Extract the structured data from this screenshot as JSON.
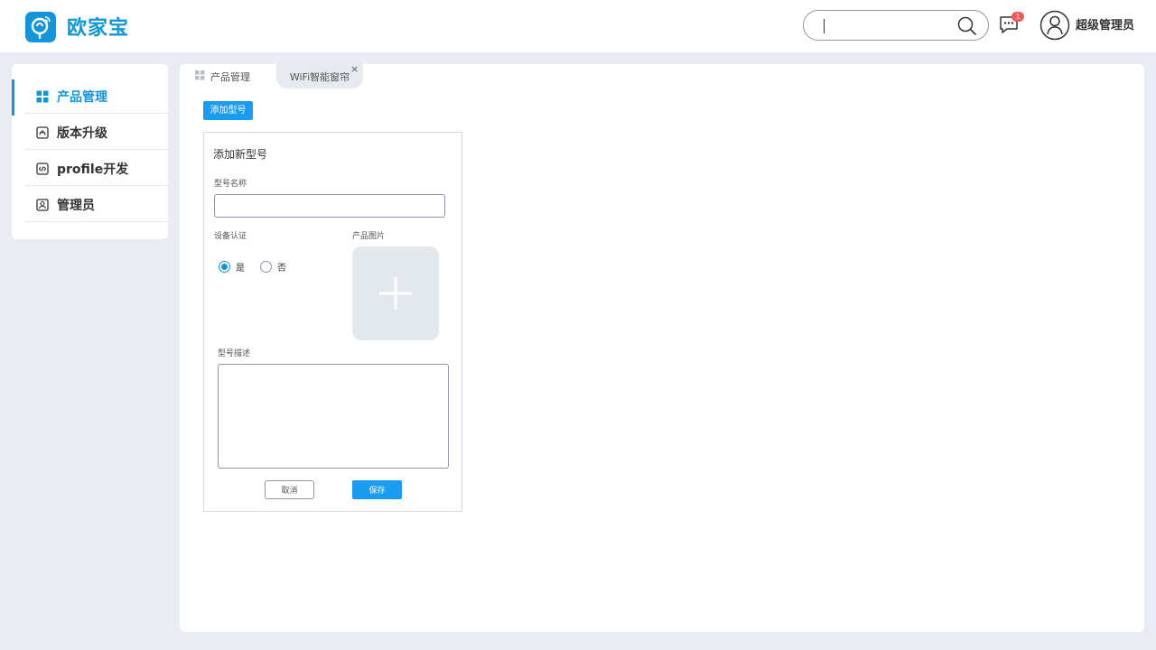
{
  "header": {
    "brand": "欧家宝",
    "search": {
      "value": ""
    },
    "messages": {
      "badge_count": "1"
    },
    "user": {
      "name": "超级管理员"
    }
  },
  "sidebar": {
    "items": [
      {
        "label": "产品管理",
        "icon": "grid-icon",
        "active": true
      },
      {
        "label": "版本升级",
        "icon": "upgrade-icon",
        "active": false
      },
      {
        "label": "profile开发",
        "icon": "code-icon",
        "active": false
      },
      {
        "label": "管理员",
        "icon": "admin-icon",
        "active": false
      }
    ]
  },
  "tabs": [
    {
      "label": "产品管理",
      "icon": "grid-icon"
    },
    {
      "label": "WiFi智能窗帘",
      "closable": true,
      "close_glyph": "×"
    }
  ],
  "toolbar": {
    "add_model_label": "添加型号"
  },
  "form": {
    "title": "添加新型号",
    "model_name": {
      "label": "型号名称",
      "value": ""
    },
    "device_cert": {
      "label": "设备认证",
      "options": [
        {
          "label": "是",
          "checked": true
        },
        {
          "label": "否",
          "checked": false
        }
      ]
    },
    "product_image": {
      "label": "产品图片"
    },
    "model_desc": {
      "label": "型号描述",
      "value": ""
    },
    "cancel_label": "取消",
    "save_label": "保存"
  },
  "colors": {
    "accent": "#1296db",
    "button": "#1a9cf0",
    "badge": "#f45a5a",
    "page_bg": "#e9ecf3"
  }
}
